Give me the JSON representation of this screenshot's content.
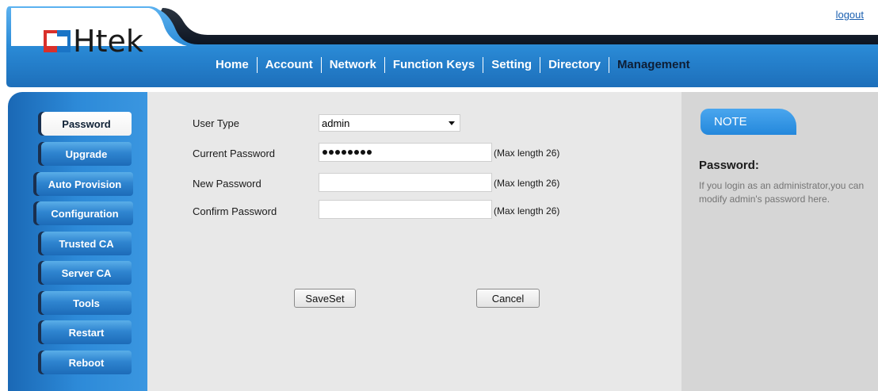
{
  "brand": {
    "logo_text": "Htek"
  },
  "header": {
    "logout_label": "logout"
  },
  "topnav": {
    "items": [
      {
        "label": "Home"
      },
      {
        "label": "Account"
      },
      {
        "label": "Network"
      },
      {
        "label": "Function Keys"
      },
      {
        "label": "Setting"
      },
      {
        "label": "Directory"
      },
      {
        "label": "Management"
      }
    ],
    "active": "Management"
  },
  "sidebar": {
    "items": [
      {
        "label": "Password"
      },
      {
        "label": "Upgrade"
      },
      {
        "label": "Auto Provision"
      },
      {
        "label": "Configuration"
      },
      {
        "label": "Trusted CA"
      },
      {
        "label": "Server CA"
      },
      {
        "label": "Tools"
      },
      {
        "label": "Restart"
      },
      {
        "label": "Reboot"
      }
    ],
    "active": "Password"
  },
  "form": {
    "user_type": {
      "label": "User Type",
      "value": "admin"
    },
    "current_password": {
      "label": "Current Password",
      "hint": "(Max length 26)",
      "masked_length": 8
    },
    "new_password": {
      "label": "New Password",
      "value": "",
      "hint": "(Max length 26)"
    },
    "confirm_password": {
      "label": "Confirm Password",
      "value": "",
      "hint": "(Max length 26)"
    },
    "save_label": "SaveSet",
    "cancel_label": "Cancel"
  },
  "note": {
    "tab_label": "NOTE",
    "title": "Password:",
    "text": "If you login as an administrator,you can modify admin's password here."
  },
  "colors": {
    "header_blue": "#2a8ad6",
    "header_dark": "#0e1e35",
    "sidebar_blue": "#2d8ad8",
    "main_bg": "#e8e8e8",
    "note_bg": "#d6d6d6",
    "logo_red": "#d9302b",
    "logo_blue": "#1a74c6"
  }
}
